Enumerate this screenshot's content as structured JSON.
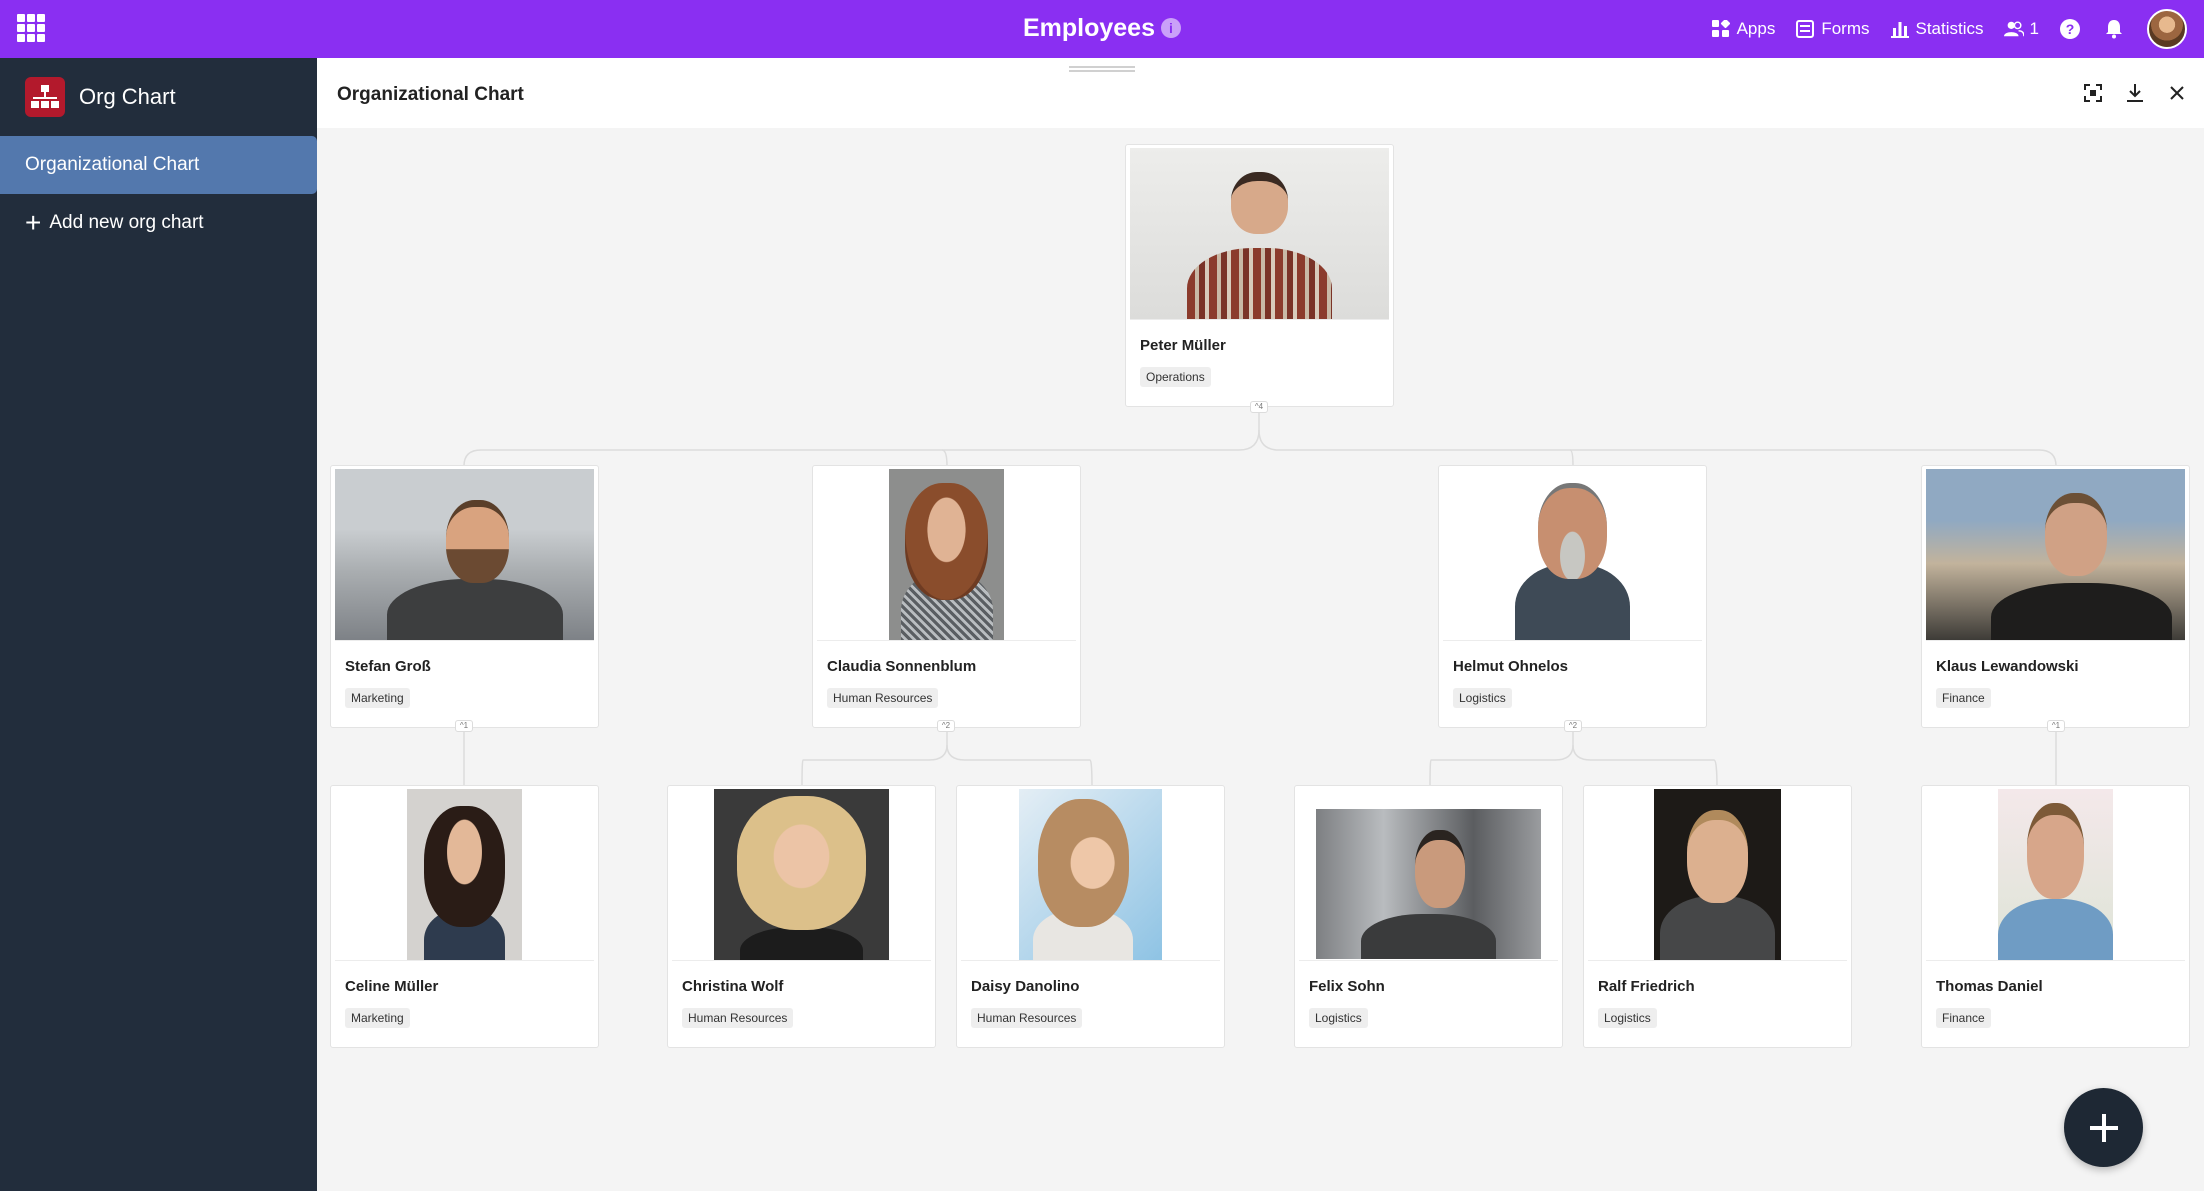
{
  "app": {
    "title": "Employees",
    "info_icon": "info-icon",
    "nav": [
      {
        "label": "Apps",
        "icon": "apps-icon"
      },
      {
        "label": "Forms",
        "icon": "forms-icon"
      },
      {
        "label": "Statistics",
        "icon": "statistics-icon"
      },
      {
        "label": "1",
        "icon": "users-icon"
      }
    ],
    "accent": "#8a2ff2"
  },
  "sidebar": {
    "title": "Org Chart",
    "items": [
      {
        "label": "Organizational Chart",
        "active": true
      },
      {
        "label": "Add new org chart",
        "icon": "plus-icon"
      }
    ]
  },
  "main": {
    "title": "Organizational Chart"
  },
  "org": {
    "root": {
      "name": "Peter Müller",
      "department": "Operations",
      "children_count": "4"
    },
    "level2": [
      {
        "name": "Stefan Groß",
        "department": "Marketing",
        "children_count": "1"
      },
      {
        "name": "Claudia Sonnenblum",
        "department": "Human Resources",
        "children_count": "2"
      },
      {
        "name": "Helmut Ohnelos",
        "department": "Logistics",
        "children_count": "2"
      },
      {
        "name": "Klaus Lewandowski",
        "department": "Finance",
        "children_count": "1"
      }
    ],
    "level3": [
      {
        "name": "Celine Müller",
        "department": "Marketing"
      },
      {
        "name": "Christina Wolf",
        "department": "Human Resources"
      },
      {
        "name": "Daisy Danolino",
        "department": "Human Resources"
      },
      {
        "name": "Felix Sohn",
        "department": "Logistics"
      },
      {
        "name": "Ralf Friedrich",
        "department": "Logistics"
      },
      {
        "name": "Thomas Daniel",
        "department": "Finance"
      }
    ]
  }
}
